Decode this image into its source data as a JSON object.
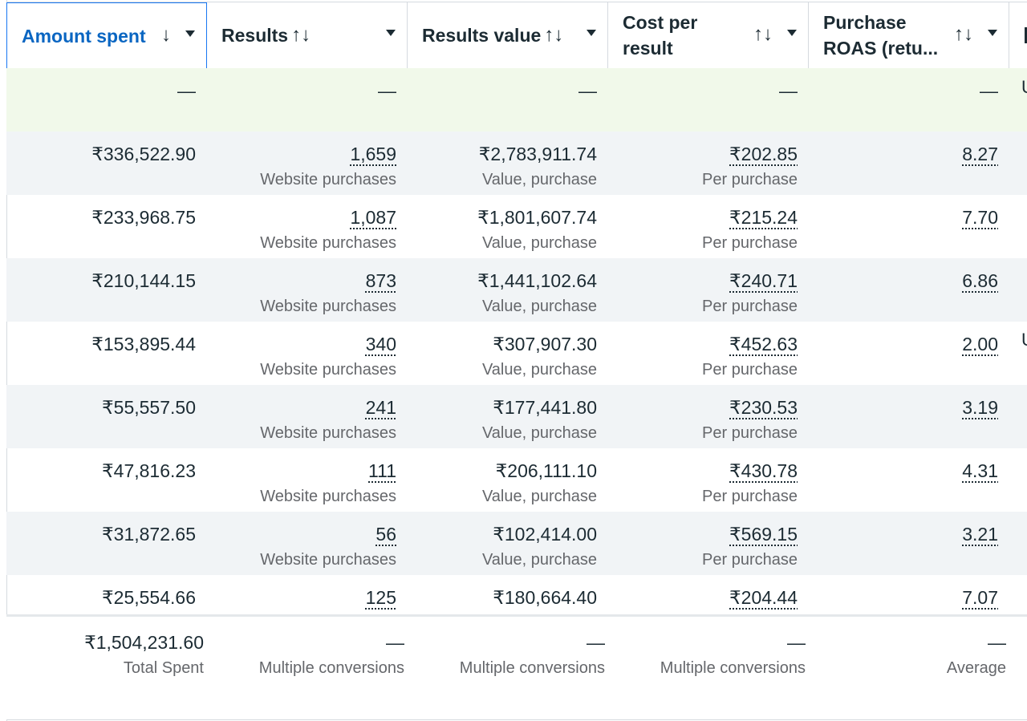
{
  "header": [
    {
      "title": "Amount spent",
      "sort": "↓",
      "active": true
    },
    {
      "title": "Results",
      "sort": "↑↓"
    },
    {
      "title": "Results value",
      "sort": "↑↓"
    },
    {
      "title": "Cost per result",
      "sort": "↑↓"
    },
    {
      "title": "Purchase ROAS (retu...",
      "sort": "↑↓"
    }
  ],
  "summary_row": [
    "—",
    "—",
    "—",
    "—",
    "—"
  ],
  "rows": [
    {
      "spent": "₹336,522.90",
      "results": "1,659",
      "results_sub": "Website purchases",
      "value": "₹2,783,911.74",
      "value_sub": "Value, purchase",
      "cpr": "₹202.85",
      "cpr_sub": "Per purchase",
      "roas": "8.27"
    },
    {
      "spent": "₹233,968.75",
      "results": "1,087",
      "results_sub": "Website purchases",
      "value": "₹1,801,607.74",
      "value_sub": "Value, purchase",
      "cpr": "₹215.24",
      "cpr_sub": "Per purchase",
      "roas": "7.70"
    },
    {
      "spent": "₹210,144.15",
      "results": "873",
      "results_sub": "Website purchases",
      "value": "₹1,441,102.64",
      "value_sub": "Value, purchase",
      "cpr": "₹240.71",
      "cpr_sub": "Per purchase",
      "roas": "6.86"
    },
    {
      "spent": "₹153,895.44",
      "results": "340",
      "results_sub": "Website purchases",
      "value": "₹307,907.30",
      "value_sub": "Value, purchase",
      "cpr": "₹452.63",
      "cpr_sub": "Per purchase",
      "roas": "2.00"
    },
    {
      "spent": "₹55,557.50",
      "results": "241",
      "results_sub": "Website purchases",
      "value": "₹177,441.80",
      "value_sub": "Value, purchase",
      "cpr": "₹230.53",
      "cpr_sub": "Per purchase",
      "roas": "3.19"
    },
    {
      "spent": "₹47,816.23",
      "results": "111",
      "results_sub": "Website purchases",
      "value": "₹206,111.10",
      "value_sub": "Value, purchase",
      "cpr": "₹430.78",
      "cpr_sub": "Per purchase",
      "roas": "4.31"
    },
    {
      "spent": "₹31,872.65",
      "results": "56",
      "results_sub": "Website purchases",
      "value": "₹102,414.00",
      "value_sub": "Value, purchase",
      "cpr": "₹569.15",
      "cpr_sub": "Per purchase",
      "roas": "3.21"
    },
    {
      "spent": "₹25,554.66",
      "results": "125",
      "results_sub": "",
      "value": "₹180,664.40",
      "value_sub": "",
      "cpr": "₹204.44",
      "cpr_sub": "",
      "roas": "7.07"
    }
  ],
  "totals": {
    "spent": "₹1,504,231.60",
    "spent_sub": "Total Spent",
    "results": "—",
    "results_sub": "Multiple conversions",
    "value": "—",
    "value_sub": "Multiple conversions",
    "cpr": "—",
    "cpr_sub": "Multiple conversions",
    "roas": "—",
    "roas_sub": "Average"
  },
  "edge_labels": {
    "summary": "U",
    "row4": "U"
  }
}
